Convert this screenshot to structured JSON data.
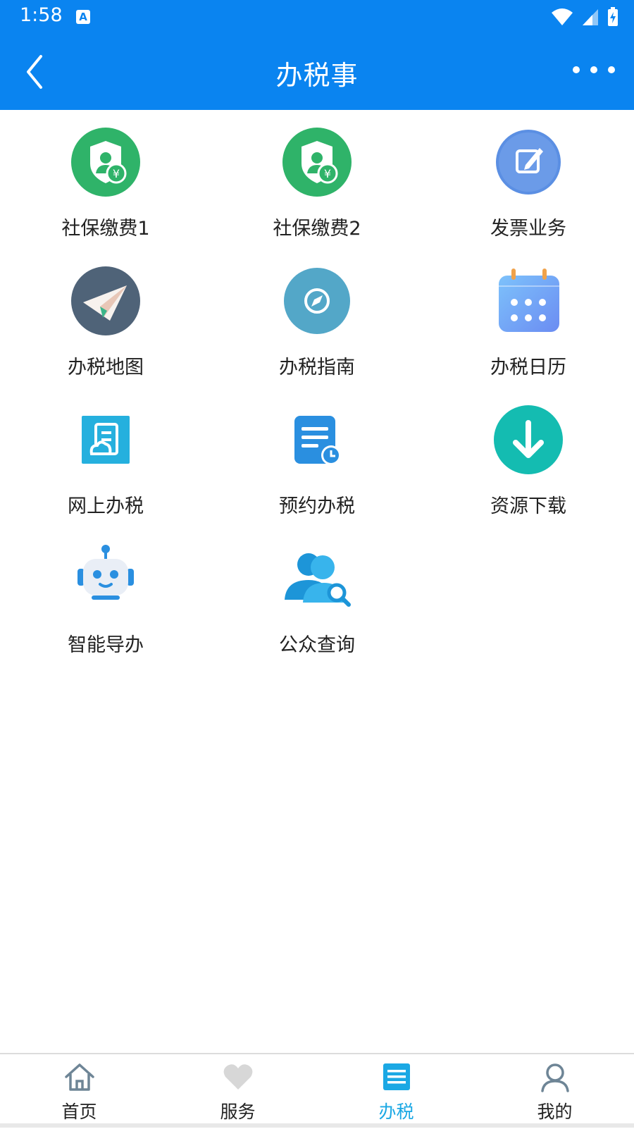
{
  "status": {
    "time": "1:58",
    "notif_letter": "A"
  },
  "header": {
    "title": "办税事"
  },
  "grid": [
    {
      "label": "社保缴费1",
      "icon": "social-insurance-icon"
    },
    {
      "label": "社保缴费2",
      "icon": "social-insurance-icon"
    },
    {
      "label": "发票业务",
      "icon": "invoice-edit-icon"
    },
    {
      "label": "办税地图",
      "icon": "paper-plane-icon"
    },
    {
      "label": "办税指南",
      "icon": "compass-icon"
    },
    {
      "label": "办税日历",
      "icon": "calendar-icon"
    },
    {
      "label": "网上办税",
      "icon": "online-document-icon"
    },
    {
      "label": "预约办税",
      "icon": "appointment-document-icon"
    },
    {
      "label": "资源下载",
      "icon": "download-icon"
    },
    {
      "label": "智能导办",
      "icon": "robot-icon"
    },
    {
      "label": "公众查询",
      "icon": "people-search-icon"
    }
  ],
  "tabs": [
    {
      "label": "首页",
      "icon": "home-icon"
    },
    {
      "label": "服务",
      "icon": "heart-icon"
    },
    {
      "label": "办税",
      "icon": "list-icon",
      "active": true
    },
    {
      "label": "我的",
      "icon": "user-icon"
    }
  ],
  "colors": {
    "primary": "#0a84f0",
    "active_tab": "#1ba8e4"
  }
}
